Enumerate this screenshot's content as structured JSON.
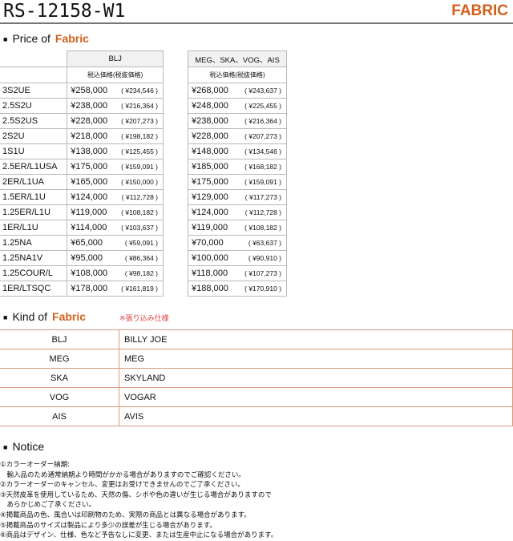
{
  "header": {
    "model": "RS-12158-W1",
    "category": "FABRIC"
  },
  "price_section": {
    "title": "Price of",
    "accent": "Fabric"
  },
  "price_tables": {
    "left": {
      "header": "BLJ",
      "subheader": "税込価格(税抜価格)",
      "rows": [
        {
          "model": "3S2UE",
          "price": "¥258,000",
          "ex": "( ¥234,546 )"
        },
        {
          "model": "2.5S2U",
          "price": "¥238,000",
          "ex": "( ¥216,364 )"
        },
        {
          "model": "2.5S2US",
          "price": "¥228,000",
          "ex": "( ¥207,273 )"
        },
        {
          "model": "2S2U",
          "price": "¥218,000",
          "ex": "( ¥198,182 )"
        },
        {
          "model": "1S1U",
          "price": "¥138,000",
          "ex": "( ¥125,455 )"
        },
        {
          "model": "2.5ER/L1USA",
          "price": "¥175,000",
          "ex": "( ¥159,091 )"
        },
        {
          "model": "2ER/L1UA",
          "price": "¥165,000",
          "ex": "( ¥150,000 )"
        },
        {
          "model": "1.5ER/L1U",
          "price": "¥124,000",
          "ex": "( ¥112,728 )"
        },
        {
          "model": "1.25ER/L1U",
          "price": "¥119,000",
          "ex": "( ¥108,182 )"
        },
        {
          "model": "1ER/L1U",
          "price": "¥114,000",
          "ex": "( ¥103,637 )"
        },
        {
          "model": "1.25NA",
          "price": "¥65,000",
          "ex": "( ¥59,091 )"
        },
        {
          "model": "1.25NA1V",
          "price": "¥95,000",
          "ex": "( ¥86,364 )"
        },
        {
          "model": "1.25COUR/L",
          "price": "¥108,000",
          "ex": "( ¥98,182 )"
        },
        {
          "model": "1ER/LTSQC",
          "price": "¥178,000",
          "ex": "( ¥161,819 )"
        }
      ]
    },
    "right": {
      "header": "MEG、SKA、VOG、AIS",
      "subheader": "税込価格(税抜価格)",
      "rows": [
        {
          "price": "¥268,000",
          "ex": "( ¥243,637 )"
        },
        {
          "price": "¥248,000",
          "ex": "( ¥225,455 )"
        },
        {
          "price": "¥238,000",
          "ex": "( ¥216,364 )"
        },
        {
          "price": "¥228,000",
          "ex": "( ¥207,273 )"
        },
        {
          "price": "¥148,000",
          "ex": "( ¥134,546 )"
        },
        {
          "price": "¥185,000",
          "ex": "( ¥168,182 )"
        },
        {
          "price": "¥175,000",
          "ex": "( ¥159,091 )"
        },
        {
          "price": "¥129,000",
          "ex": "( ¥117,273 )"
        },
        {
          "price": "¥124,000",
          "ex": "( ¥112,728 )"
        },
        {
          "price": "¥119,000",
          "ex": "( ¥108,182 )"
        },
        {
          "price": "¥70,000",
          "ex": "( ¥63,637 )"
        },
        {
          "price": "¥100,000",
          "ex": "( ¥90,910 )"
        },
        {
          "price": "¥118,000",
          "ex": "( ¥107,273 )"
        },
        {
          "price": "¥188,000",
          "ex": "( ¥170,910 )"
        }
      ]
    }
  },
  "kind_section": {
    "title": "Kind of",
    "accent": "Fabric",
    "note": "※張り込み仕様"
  },
  "kinds": [
    {
      "code": "BLJ",
      "name": "BILLY JOE"
    },
    {
      "code": "MEG",
      "name": "MEG"
    },
    {
      "code": "SKA",
      "name": "SKYLAND"
    },
    {
      "code": "VOG",
      "name": "VOGAR"
    },
    {
      "code": "AIS",
      "name": "AVIS"
    }
  ],
  "notice": {
    "title": "Notice",
    "lines": [
      "①カラーオーダー納期:",
      "　輸入品のため通常納期より時間がかかる場合がありますのでご確認ください。",
      "②カラーオーダーのキャンセル、変更はお受けできませんのでご了承ください。",
      "③天然皮革を使用しているため、天然の傷、シボや色の違いが生じる場合がありますので",
      "　あらかじめご了承ください。",
      "④掲載商品の色、風合いは印刷物のため、実際の商品とは異なる場合があります。",
      "⑤掲載商品のサイズは製品により多少の誤差が生じる場合があります。",
      "⑥商品はデザイン、仕様、色など予告なしに変更、または生産中止になる場合があります。"
    ]
  }
}
